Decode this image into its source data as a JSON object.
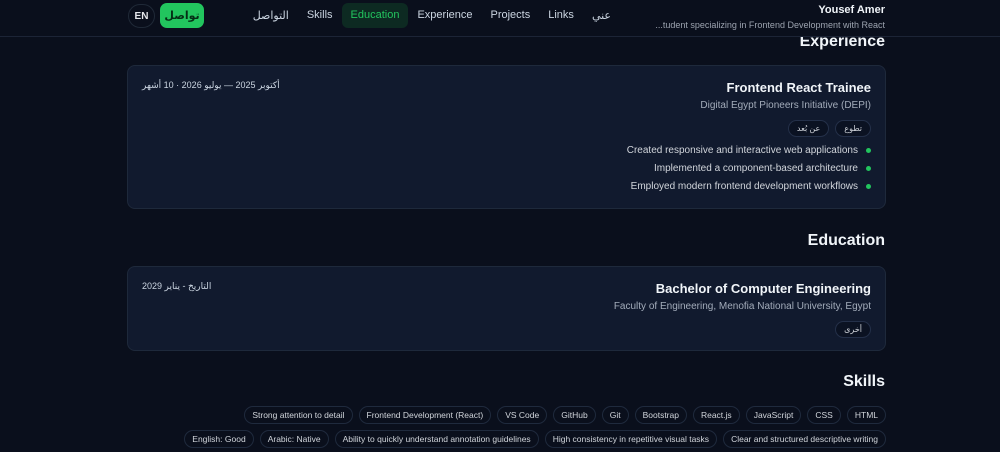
{
  "header": {
    "lang": "EN",
    "contact_button": "تواصل",
    "nav": [
      "عني",
      "Links",
      "Projects",
      "Experience",
      "Education",
      "Skills",
      "التواصل"
    ],
    "active": "Education",
    "name": "Yousef Amer",
    "bio": "...tudent specializing in Frontend Development with React"
  },
  "experience": {
    "title": "Experience",
    "job_title": "Frontend React Trainee",
    "org": "Digital Egypt Pioneers Initiative (DEPI)",
    "date": "أكتوبر 2025 — يوليو 2026 · 10 أشهر",
    "tags": [
      "تطوع",
      "عن بُعد"
    ],
    "bullets": [
      "Created responsive and interactive web applications",
      "Implemented a component-based architecture",
      "Employed modern frontend development workflows"
    ]
  },
  "education": {
    "title": "Education",
    "degree": "Bachelor of Computer Engineering",
    "org": "Faculty of Engineering, Menofia National University, Egypt",
    "date": "التاريخ - يناير 2029",
    "tags": [
      "أخرى"
    ]
  },
  "skills": {
    "title": "Skills",
    "items": [
      "HTML",
      "CSS",
      "JavaScript",
      "React.js",
      "Bootstrap",
      "Git",
      "GitHub",
      "VS Code",
      "Frontend Development (React)",
      "Strong attention to detail",
      "Clear and structured descriptive writing",
      "High consistency in repetitive visual tasks",
      "Ability to quickly understand annotation guidelines",
      "Arabic: Native",
      "English: Good"
    ]
  },
  "colors": {
    "accent": "#22c55e",
    "background": "#0a0f1c",
    "card": "#111a2e"
  }
}
